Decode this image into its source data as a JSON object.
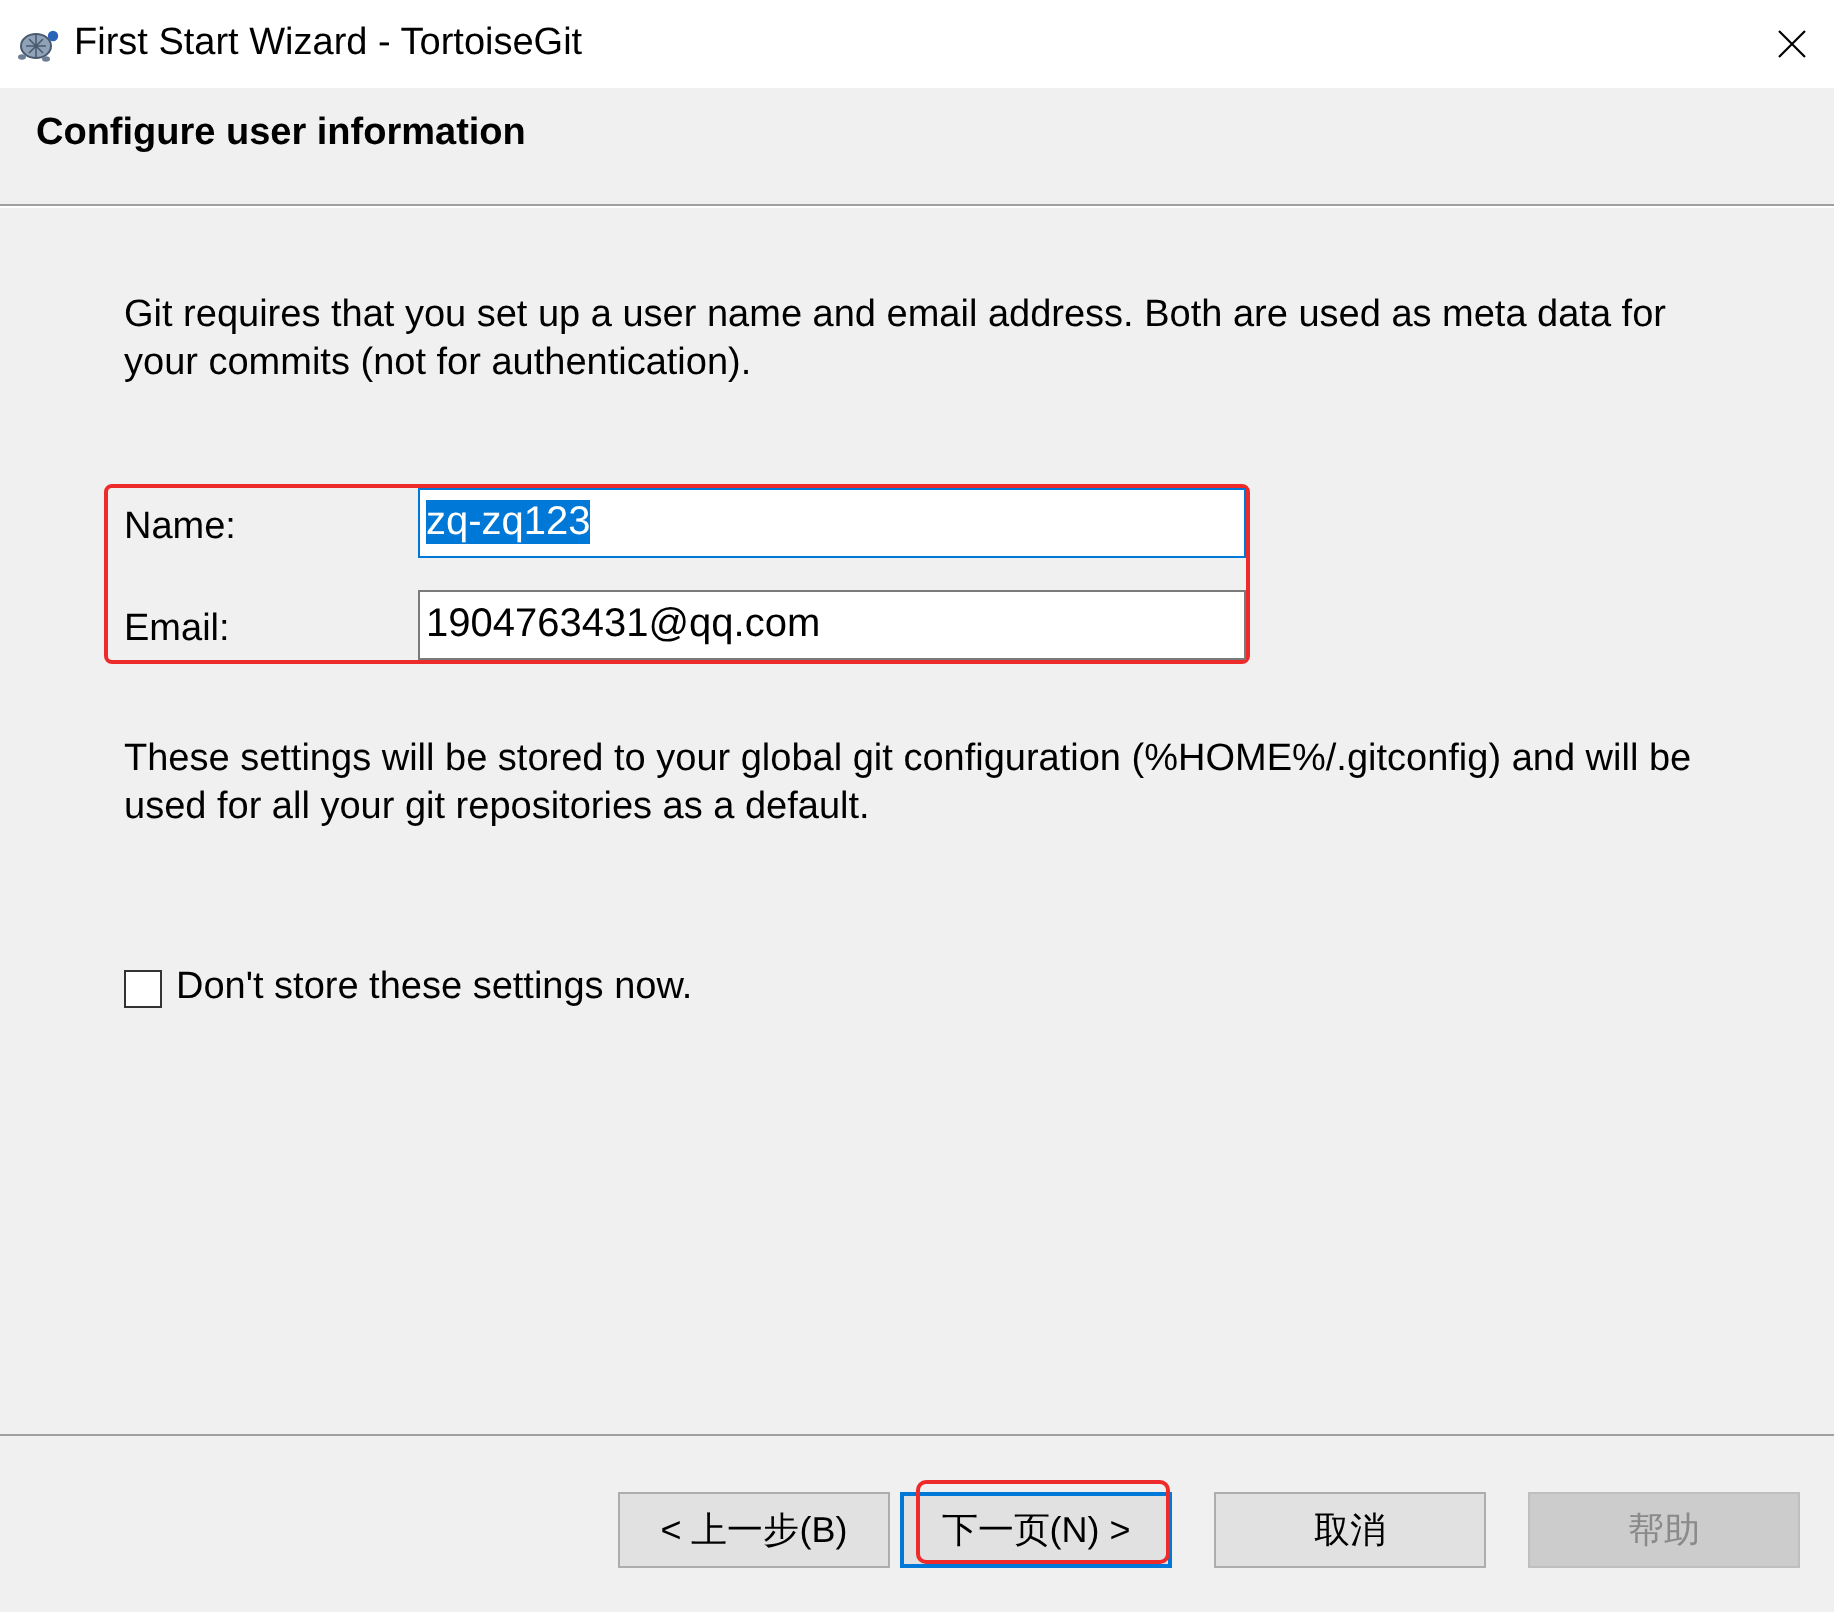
{
  "window": {
    "title": "First Start Wizard - TortoiseGit"
  },
  "header": {
    "title": "Configure user information"
  },
  "intro": "Git requires that you set up a user name and email address. Both are used as meta data for your commits (not for authentication).",
  "user_fields": {
    "highlighted": true,
    "fields": [
      {
        "label": "Name:",
        "value": "zq-zq123",
        "focused": true,
        "text_selected": true
      },
      {
        "label": "Email:",
        "value": "1904763431@qq.com",
        "focused": false,
        "text_selected": false
      }
    ]
  },
  "note": "These settings will be stored to your global git configuration (%HOME%/.gitconfig) and will be used for all your git repositories as a default.",
  "dont_store": {
    "label": "Don't store these settings now.",
    "checked": false
  },
  "buttons": [
    {
      "label": "< 上一步(B)",
      "default": false,
      "disabled": false,
      "highlighted": false
    },
    {
      "label": "下一页(N) >",
      "default": true,
      "disabled": false,
      "highlighted": true
    },
    {
      "label": "取消",
      "default": false,
      "disabled": false,
      "highlighted": false
    },
    {
      "label": "帮助",
      "default": false,
      "disabled": true,
      "highlighted": false
    }
  ]
}
